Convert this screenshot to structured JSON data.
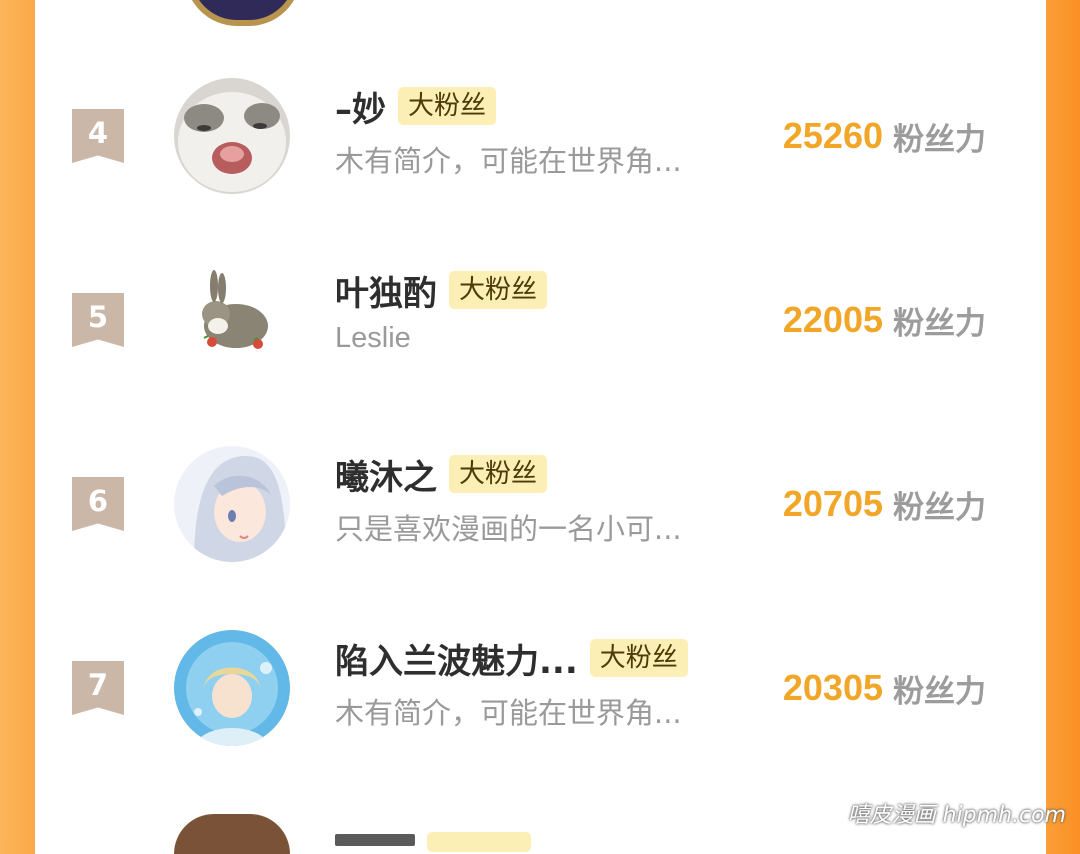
{
  "ranking": [
    {
      "rank": "4",
      "name": "–妙",
      "badge": "大粉丝",
      "bio": "木有简介，可能在世界角...",
      "score": "25260",
      "unit": "粉丝力",
      "avatar": "cat-avatar"
    },
    {
      "rank": "5",
      "name": "叶独酌",
      "badge": "大粉丝",
      "bio": "Leslie",
      "score": "22005",
      "unit": "粉丝力",
      "avatar": "rabbit-avatar"
    },
    {
      "rank": "6",
      "name": "曦沐之",
      "badge": "大粉丝",
      "bio": "只是喜欢漫画的一名小可...",
      "score": "20705",
      "unit": "粉丝力",
      "avatar": "anime-girl-avatar"
    },
    {
      "rank": "7",
      "name": "陷入兰波魅力...",
      "badge": "大粉丝",
      "bio": "木有简介，可能在世界角...",
      "score": "20305",
      "unit": "粉丝力",
      "avatar": "anime-boy-avatar"
    }
  ],
  "watermark": "嘻皮漫画 hipmh.com",
  "colors": {
    "score": "#f2a627",
    "badge_bg": "#fcefb6",
    "rank_bg": "#cbb7a7",
    "side_orange": "#fba949"
  }
}
